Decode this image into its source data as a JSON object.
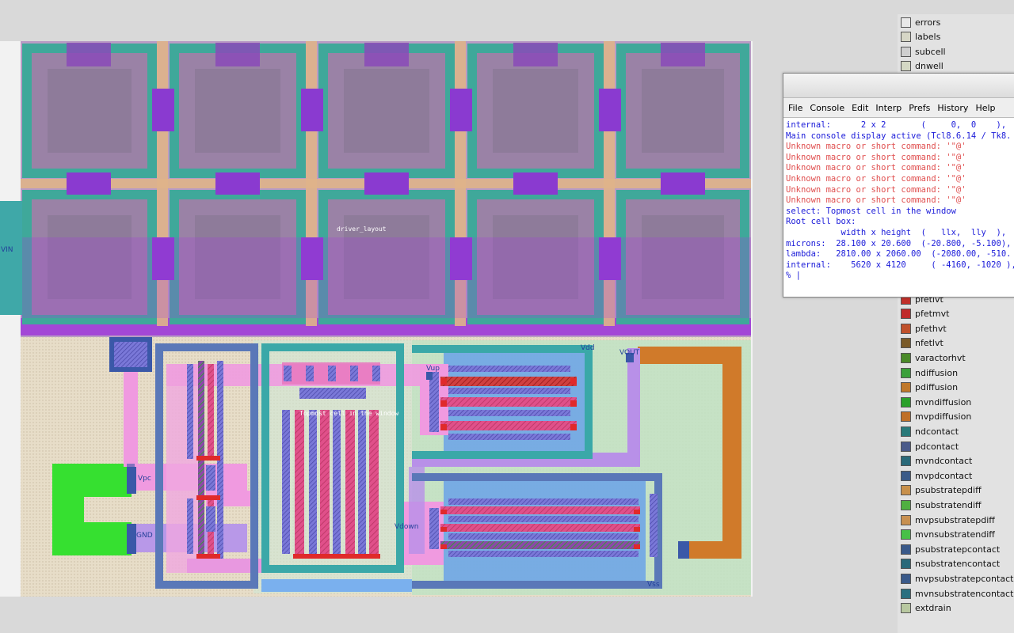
{
  "layout": {
    "cell_name": "driver_layout",
    "overlay_label": "Topmost cell in the window",
    "port_labels": {
      "vin": "VIN",
      "vdd": "Vdd",
      "vout": "VOUT",
      "vup": "Vup",
      "vpc": "Vpc",
      "gnd": "GND",
      "vdown": "Vdown",
      "vss": "Vss"
    }
  },
  "console": {
    "menu": [
      "File",
      "Console",
      "Edit",
      "Interp",
      "Prefs",
      "History",
      "Help"
    ],
    "lines": [
      {
        "text": "internal:      2 x 2       (     0,  0    ),",
        "kind": "info"
      },
      {
        "text": "Main console display active (Tcl8.6.14 / Tk8.",
        "kind": "info"
      },
      {
        "text": "Unknown macro or short command: '\"@'",
        "kind": "error"
      },
      {
        "text": "Unknown macro or short command: '\"@'",
        "kind": "error"
      },
      {
        "text": "Unknown macro or short command: '\"@'",
        "kind": "error"
      },
      {
        "text": "Unknown macro or short command: '\"@'",
        "kind": "error"
      },
      {
        "text": "Unknown macro or short command: '\"@'",
        "kind": "error"
      },
      {
        "text": "Unknown macro or short command: '\"@'",
        "kind": "error"
      },
      {
        "text": "select: Topmost cell in the window",
        "kind": "info"
      },
      {
        "text": "Root cell box:",
        "kind": "info"
      },
      {
        "text": "           width x height  (   llx,  lly  ),",
        "kind": "info"
      },
      {
        "text": "",
        "kind": "info"
      },
      {
        "text": "microns:  28.100 x 20.600  (-20.800, -5.100),",
        "kind": "info"
      },
      {
        "text": "lambda:   2810.00 x 2060.00  (-2080.00, -510.",
        "kind": "info"
      },
      {
        "text": "internal:    5620 x 4120     ( -4160, -1020 ),",
        "kind": "info"
      },
      {
        "text": "% |",
        "kind": "prompt"
      }
    ]
  },
  "layers_top": [
    {
      "name": "errors",
      "color": "#e8e8e8"
    },
    {
      "name": "labels",
      "color": "#d6d6c6"
    },
    {
      "name": "subcell",
      "color": "#cfcfcf"
    },
    {
      "name": "dnwell",
      "color": "#d4d8c4"
    }
  ],
  "layers": [
    {
      "name": "pfetlvt",
      "color": "#c0302a"
    },
    {
      "name": "pfetmvt",
      "color": "#c02a2a"
    },
    {
      "name": "pfethvt",
      "color": "#c0502a"
    },
    {
      "name": "nfetlvt",
      "color": "#7a5a28"
    },
    {
      "name": "varactorhvt",
      "color": "#4a8a28"
    },
    {
      "name": "ndiffusion",
      "color": "#3aa03a"
    },
    {
      "name": "pdiffusion",
      "color": "#c0782a"
    },
    {
      "name": "mvndiffusion",
      "color": "#2aa02a"
    },
    {
      "name": "mvpdiffusion",
      "color": "#c07028"
    },
    {
      "name": "ndcontact",
      "color": "#2a7a7a"
    },
    {
      "name": "pdcontact",
      "color": "#4a5a8a"
    },
    {
      "name": "mvndcontact",
      "color": "#2a6a7a"
    },
    {
      "name": "mvpdcontact",
      "color": "#3a5a88"
    },
    {
      "name": "psubstratepdiff",
      "color": "#c8904a"
    },
    {
      "name": "nsubstratendiff",
      "color": "#50b040"
    },
    {
      "name": "mvpsubstratepdiff",
      "color": "#c89050"
    },
    {
      "name": "mvnsubstratendiff",
      "color": "#48c048"
    },
    {
      "name": "psubstratepcontact",
      "color": "#3a5a8a"
    },
    {
      "name": "nsubstratencontact",
      "color": "#2a6a7a"
    },
    {
      "name": "mvpsubstratepcontact",
      "color": "#3a5a8a"
    },
    {
      "name": "mvnsubstratencontact",
      "color": "#2a7080"
    },
    {
      "name": "extdrain",
      "color": "#b8c8a0"
    }
  ]
}
